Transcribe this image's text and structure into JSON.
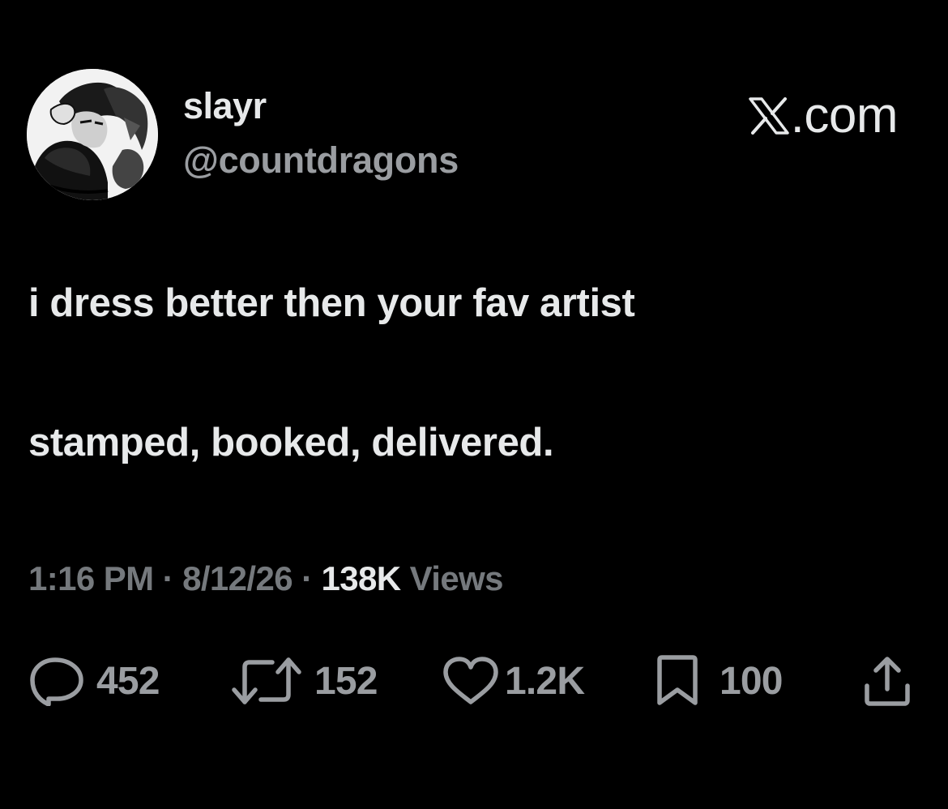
{
  "author": {
    "display_name": "slayr",
    "handle": "@countdragons",
    "avatar": "avatar-manga-illustration"
  },
  "brand": {
    "logo": "x-logo-icon",
    "text": ".com"
  },
  "tweet": {
    "lines": [
      "i dress better then your fav artist",
      "stamped, booked, delivered."
    ]
  },
  "meta": {
    "time": "1:16 PM",
    "separator": " · ",
    "date": "8/12/26",
    "views_count": "138K",
    "views_label": "Views"
  },
  "actions": {
    "reply": {
      "icon": "reply-icon",
      "count": "452"
    },
    "retweet": {
      "icon": "retweet-icon",
      "count": "152"
    },
    "like": {
      "icon": "heart-icon",
      "count": "1.2K"
    },
    "bookmark": {
      "icon": "bookmark-icon",
      "count": "100"
    },
    "share": {
      "icon": "share-icon"
    }
  },
  "colors": {
    "background": "#000000",
    "primary_text": "#e7e9ea",
    "secondary_text": "#9a9da1",
    "meta_text": "#75797d"
  }
}
